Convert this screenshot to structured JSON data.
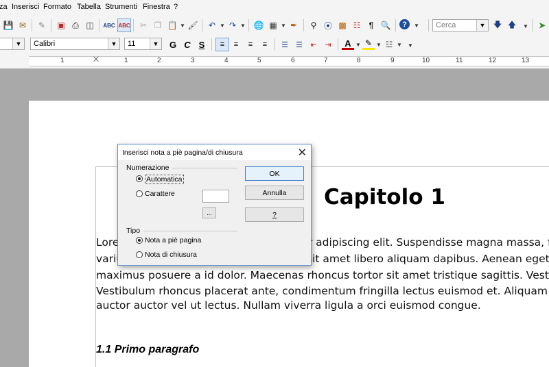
{
  "menubar": {
    "items": [
      {
        "label": "za"
      },
      {
        "label": "Inserisci"
      },
      {
        "label": "Formato"
      },
      {
        "label": "Tabella"
      },
      {
        "label": "Strumenti"
      },
      {
        "label": "Finestra"
      },
      {
        "label": "?"
      }
    ]
  },
  "toolbar": {
    "search_placeholder": "Cerca",
    "font_name": "Calibri",
    "font_size": "11",
    "bold_label": "G",
    "italic_label": "C",
    "underline_label": "S"
  },
  "ruler": {
    "numbers": [
      "1",
      "1",
      "2",
      "3",
      "4",
      "5",
      "6",
      "7",
      "8",
      "9",
      "10",
      "11",
      "12",
      "13"
    ]
  },
  "document": {
    "chapter_title": "Capitolo 1",
    "body_lines": [
      "Lorem ipsum dolor sit amet, consectetur adipiscing elit. Suspendisse magna massa, frin",
      "varius at, ullamcorper ut lectus. Donec sit amet libero aliquam dapibus. Aenean eget nib",
      "maximus posuere a id dolor. Maecenas rhoncus tortor sit amet tristique sagittis. Vestibu",
      "Vestibulum rhoncus placerat ante, condimentum fringilla lectus euismod et. Aliquam id",
      "auctor auctor vel ut lectus. Nullam viverra ligula a orci euismod congue."
    ],
    "subheading": "1.1 Primo paragrafo"
  },
  "dialog": {
    "title": "Inserisci nota a piè pagina/di chiusura",
    "numbering_label": "Numerazione",
    "automatic_label": "Automatica",
    "character_label": "Carattere",
    "character_value": "",
    "browse_label": "...",
    "type_label": "Tipo",
    "footnote_label": "Nota a piè pagina",
    "endnote_label": "Nota di chiusura",
    "ok_label": "OK",
    "cancel_label": "Annulla",
    "help_label": "?"
  }
}
